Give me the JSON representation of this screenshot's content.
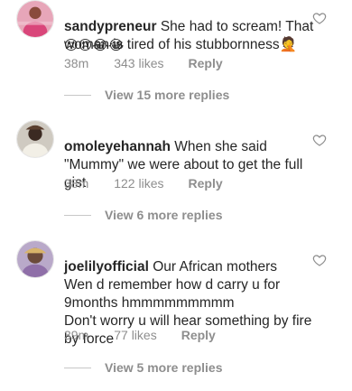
{
  "comments": [
    {
      "username": "sandypreneur",
      "text": " She had to scream! That woman is tired of his stubbornness🤦",
      "emojis": "😢😢😂😂",
      "time": "38m",
      "likes": "343 likes",
      "reply": "Reply",
      "view_more": "View 15 more replies"
    },
    {
      "username": "omoleyehannah",
      "text": " When  she said \"Mummy\"  we were about to get the full gist",
      "time": "38m",
      "likes": "122 likes",
      "reply": "Reply",
      "view_more": "View 6 more replies"
    },
    {
      "username": "joelilyofficial",
      "text": " Our African mothers\nWen d remember how d carry u for 9months hmmmmmmmmm\nDon't worry u will hear something by fire by force",
      "time": "39m",
      "likes": "77 likes",
      "reply": "Reply",
      "view_more": "View 5 more replies"
    }
  ],
  "colors": {
    "text": "#262626",
    "secondary": "#8e8e8e",
    "heart": "#8e8e8e"
  },
  "icons": {
    "heart": "heart-outline-icon"
  }
}
